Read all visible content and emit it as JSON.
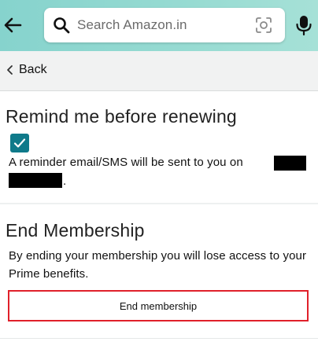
{
  "header": {
    "search_placeholder": "Search Amazon.in",
    "icons": {
      "back": "back-arrow-icon",
      "search": "search-icon",
      "camera": "camera-scan-icon",
      "mic": "mic-icon"
    },
    "background_color": "#8fd6cf"
  },
  "nav": {
    "back_label": "Back"
  },
  "remind": {
    "title": "Remind me before renewing",
    "checkbox_checked": true,
    "checkbox_color": "#0f7a8a",
    "reminder_text": "A reminder email/SMS will be sent to you on"
  },
  "membership": {
    "title": "End Membership",
    "description": "By ending your membership you will lose access to your Prime benefits.",
    "button_label": "End membership",
    "button_border_color": "#e0202a"
  }
}
